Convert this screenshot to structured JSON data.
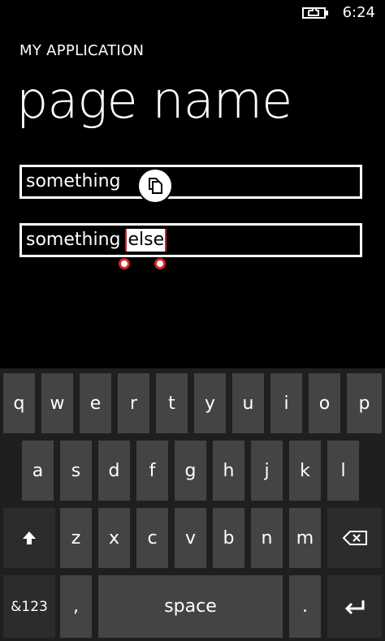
{
  "status": {
    "time": "6:24",
    "battery_icon": "battery-charging-icon"
  },
  "app": {
    "title": "MY APPLICATION",
    "page_name": "page name"
  },
  "fields": [
    {
      "value": "something"
    },
    {
      "value_before": "something",
      "selected": "else"
    }
  ],
  "context_menu": {
    "copy_icon": "copy-icon"
  },
  "keyboard": {
    "row1": [
      "q",
      "w",
      "e",
      "r",
      "t",
      "y",
      "u",
      "i",
      "o",
      "p"
    ],
    "row2": [
      "a",
      "s",
      "d",
      "f",
      "g",
      "h",
      "j",
      "k",
      "l"
    ],
    "row3": [
      "z",
      "x",
      "c",
      "v",
      "b",
      "n",
      "m"
    ],
    "shift_icon": "shift-arrow-icon",
    "backspace_icon": "backspace-icon",
    "symbols_label": "&123",
    "comma_label": ",",
    "space_label": "space",
    "period_label": ".",
    "enter_icon": "enter-icon"
  },
  "colors": {
    "background": "#000000",
    "key": "#444444",
    "key_dark": "#2c2c2c",
    "selection_accent": "#d1252b"
  }
}
